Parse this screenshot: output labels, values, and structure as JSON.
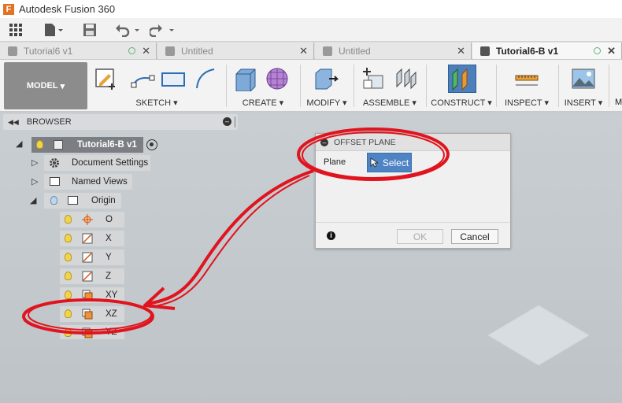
{
  "app": {
    "title": "Autodesk Fusion 360",
    "logo_letter": "F"
  },
  "tabs": [
    {
      "label": "Tutorial6 v1",
      "active": false
    },
    {
      "label": "Untitled",
      "active": false
    },
    {
      "label": "Untitled",
      "active": false
    },
    {
      "label": "Tutorial6-B v1",
      "active": true
    }
  ],
  "toolbar": {
    "workspace": "MODEL",
    "groups": [
      "SKETCH",
      "CREATE",
      "MODIFY",
      "ASSEMBLE",
      "CONSTRUCT",
      "INSPECT",
      "INSERT"
    ],
    "trailing_letter": "M"
  },
  "browser": {
    "title": "BROWSER",
    "root": "Tutorial6-B v1",
    "items": [
      "Document Settings",
      "Named Views",
      "Origin"
    ],
    "origin_items": [
      "O",
      "X",
      "Y",
      "Z",
      "XY",
      "XZ",
      "YZ"
    ]
  },
  "dialog": {
    "title": "OFFSET PLANE",
    "plane_label": "Plane",
    "select_label": "Select",
    "ok_label": "OK",
    "cancel_label": "Cancel"
  },
  "colors": {
    "accent": "#4e84c3",
    "annotation": "#e0141e",
    "brand": "#e37323"
  }
}
